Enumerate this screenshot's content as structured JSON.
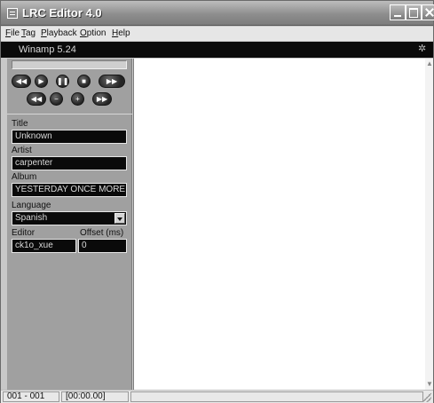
{
  "window": {
    "title": "LRC Editor 4.0"
  },
  "menu": [
    {
      "key": "F",
      "rest": "ile"
    },
    {
      "key": "T",
      "rest": "ag"
    },
    {
      "key": "P",
      "rest": "layback"
    },
    {
      "key": "O",
      "rest": "ption"
    },
    {
      "key": "H",
      "rest": "elp"
    }
  ],
  "player": {
    "name": "Winamp 5.24",
    "progress": 0
  },
  "controls": {
    "row1": [
      "rewind-icon",
      "play-icon",
      "pause-icon",
      "stop-icon",
      "fast-forward-icon"
    ],
    "row2": [
      "previous-icon",
      "volume-down-icon",
      "volume-up-icon",
      "next-icon"
    ]
  },
  "fields": {
    "title_label": "Title",
    "title_value": "Unknown",
    "artist_label": "Artist",
    "artist_value": "carpenter",
    "album_label": "Album",
    "album_value": "YESTERDAY ONCE MORE",
    "language_label": "Language",
    "language_value": "Spanish",
    "editor_label": "Editor",
    "editor_value": "ck1o_xue",
    "offset_label": "Offset (ms)",
    "offset_value": "0"
  },
  "status": {
    "line": "001 - 001",
    "time": "[00:00.00]"
  }
}
